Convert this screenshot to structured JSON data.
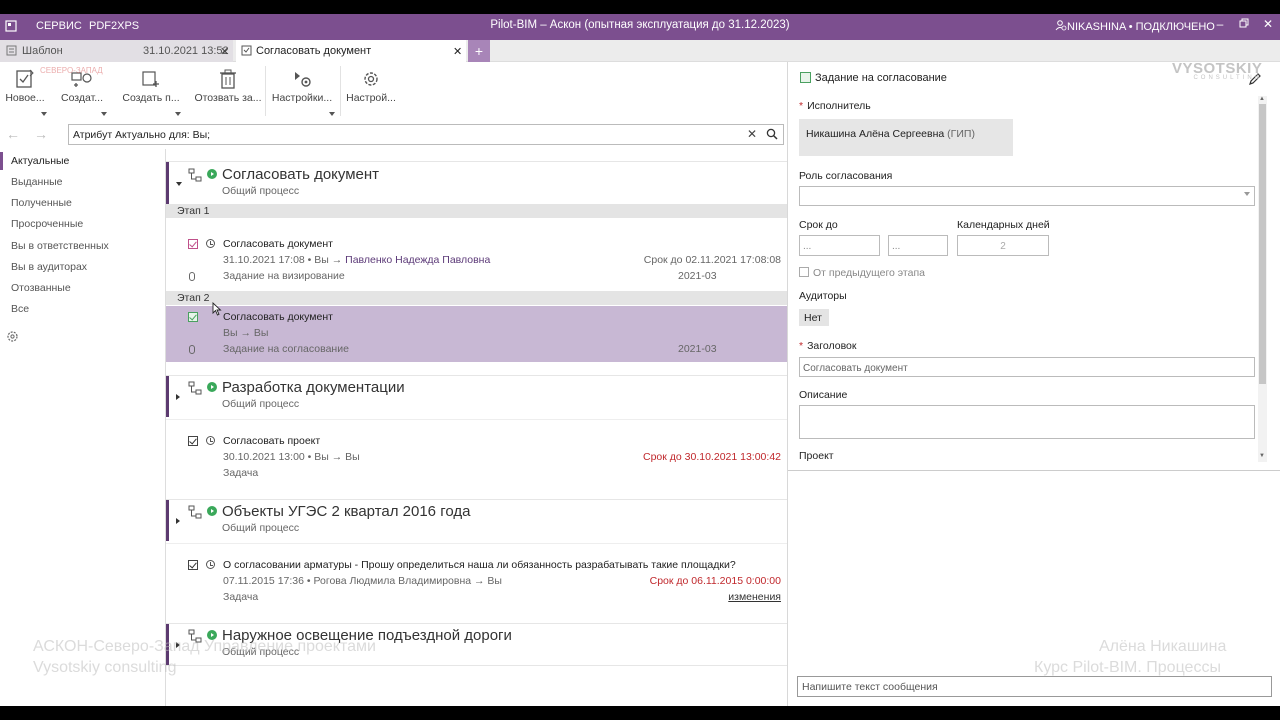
{
  "titlebar": {
    "menu_service": "СЕРВИС",
    "menu_pdf": "PDF2XPS",
    "window_title": "Pilot-BIM – Аскон (опытная эксплуатация до 31.12.2023)",
    "user": "NIKASHINA • ПОДКЛЮЧЕНО"
  },
  "tabs": [
    {
      "label": "Шаблон",
      "date": "31.10.2021 13:52"
    },
    {
      "label": "Согласовать документ"
    }
  ],
  "toolbar": {
    "new": "Новое...",
    "create": "Создат...",
    "create_p": "Создать п...",
    "cancel": "Отозвать за...",
    "settings1": "Настройки...",
    "settings2": "Настрой..."
  },
  "search": {
    "value": "Атрибут Актуально для: Вы;"
  },
  "sidebar": {
    "items": [
      {
        "label": "Актуальные"
      },
      {
        "label": "Выданные"
      },
      {
        "label": "Полученные"
      },
      {
        "label": "Просроченные"
      },
      {
        "label": "Вы в ответственных"
      },
      {
        "label": "Вы в аудиторах"
      },
      {
        "label": "Отозванные"
      },
      {
        "label": "Все"
      }
    ]
  },
  "groups": [
    {
      "title": "Согласовать документ",
      "subtitle": "Общий процесс",
      "stages": [
        {
          "label": "Этап 1",
          "task": {
            "title": "Согласовать документ",
            "date": "31.10.2021 17:08",
            "from": "Вы →",
            "to": "Павленко Надежда Павловна",
            "deadline": "Срок до 02.11.2021 17:08:08",
            "attachment": "Задание на визирование",
            "code": "2021-03"
          }
        },
        {
          "label": "Этап 2",
          "task": {
            "title": "Согласовать документ",
            "meta": "Вы → Вы",
            "attachment": "Задание на согласование",
            "code": "2021-03"
          }
        }
      ]
    },
    {
      "title": "Разработка документации",
      "subtitle": "Общий процесс",
      "task": {
        "title": "Согласовать проект",
        "meta": "30.10.2021 13:00 • Вы → Вы",
        "deadline": "Срок до 30.10.2021 13:00:42",
        "kind": "Задача"
      }
    },
    {
      "title": "Объекты УГЭС 2 квартал 2016 года",
      "subtitle": "Общий процесс",
      "task": {
        "title": "О согласовании арматуры - Прошу определиться наша ли обязанность разрабатывать такие площадки?",
        "meta": "07.11.2015 17:36 • Рогова Людмила Владимировна → Вы",
        "deadline": "Срок до 06.11.2015 0:00:00",
        "kind": "Задача",
        "link": "изменения"
      }
    },
    {
      "title": "Наружное освещение подъездной дороги",
      "subtitle": "Общий процесс"
    }
  ],
  "panel": {
    "header": "Задание на согласование",
    "executor_label": "Исполнитель",
    "executor_name": "Никашина Алёна Сергеевна",
    "executor_role": "(ГИП)",
    "role_label": "Роль согласования",
    "deadline_label": "Срок до",
    "date_placeholder": "...",
    "time_placeholder": "...",
    "calendar_label": "Календарных дней",
    "calendar_value": "2",
    "from_prev": "От предыдущего этапа",
    "auditors_label": "Аудиторы",
    "auditors_value": "Нет",
    "heading_label": "Заголовок",
    "heading_value": "Согласовать документ",
    "description_label": "Описание",
    "project_label": "Проект",
    "message_placeholder": "Напишите текст сообщения"
  },
  "watermarks": {
    "left1": "АСКОН-Северо-Запад Управление проектами",
    "left2": "Vysotskiy consulting",
    "right1": "Алёна Никашина",
    "right2": "Курс Pilot-BIM. Процессы",
    "logo": "VYSOTSKIY",
    "logo_sub": "CONSULTING",
    "red": "СЕВЕРО-ЗАПАД"
  },
  "colors": {
    "brand": "#7c4f8f",
    "selected_row": "#c8b8d4",
    "deadline_red": "#c0282c",
    "status_green": "#3aa85a"
  }
}
